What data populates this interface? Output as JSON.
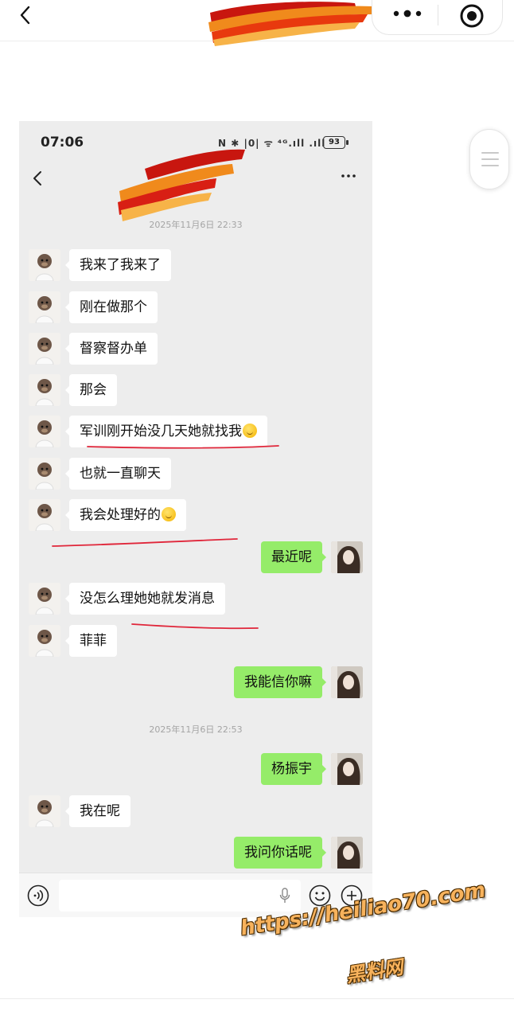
{
  "outer": {
    "back_icon": "chevron-left-icon",
    "more_icon": "more-dots-icon",
    "record_icon": "record-target-icon"
  },
  "status": {
    "time": "07:06",
    "icons_text": "N ✱ |0| ᯤ ⁴ᴳ.ıll .ıll",
    "battery": "93"
  },
  "chat": {
    "timestamps": [
      "2025年11月6日 22:33",
      "2025年11月6日 22:53"
    ],
    "messages": [
      {
        "side": "left",
        "text": "我来了我来了"
      },
      {
        "side": "left",
        "text": "刚在做那个"
      },
      {
        "side": "left",
        "text": "督察督办单"
      },
      {
        "side": "left",
        "text": "那会"
      },
      {
        "side": "left",
        "text": "军训刚开始没几天她就找我"
      },
      {
        "side": "left",
        "text": "也就一直聊天"
      },
      {
        "side": "left",
        "text": "我会处理好的"
      },
      {
        "side": "right",
        "text": "最近呢"
      },
      {
        "side": "left",
        "text": "没怎么理她她就发消息"
      },
      {
        "side": "left",
        "text": "菲菲"
      },
      {
        "side": "right",
        "text": "我能信你嘛"
      },
      {
        "side": "right",
        "text": "杨振宇"
      },
      {
        "side": "left",
        "text": "我在呢"
      },
      {
        "side": "right",
        "text": "我问你话呢"
      }
    ]
  },
  "input": {
    "value": "",
    "placeholder": ""
  },
  "watermark": {
    "url": "https://heiliao70.com",
    "name": "黑料网"
  },
  "colors": {
    "sent_bubble": "#95ec69",
    "received_bubble": "#ffffff",
    "chat_bg": "#ededed",
    "annotation_red": "#e0263a"
  }
}
